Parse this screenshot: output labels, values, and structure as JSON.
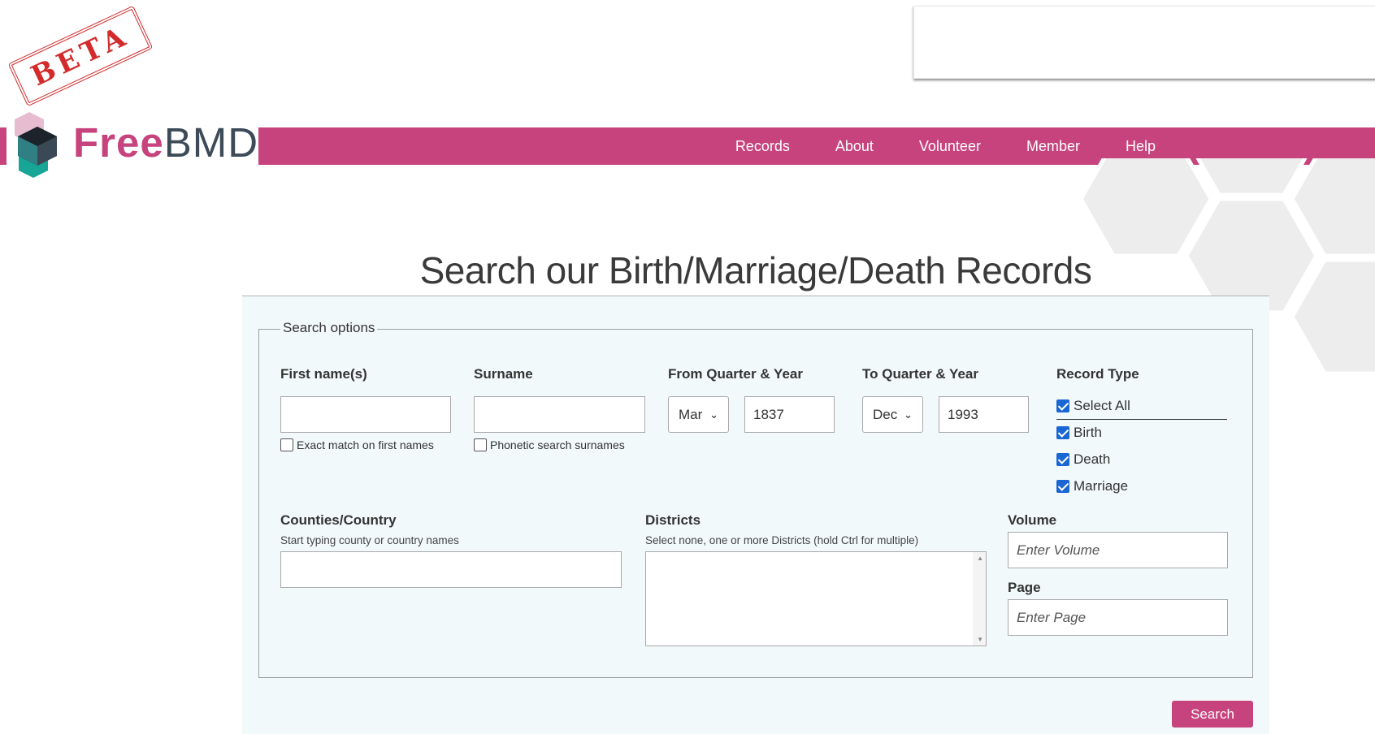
{
  "beta_label": "BETA",
  "brand": {
    "free": "Free",
    "bmd": "BMD",
    "accent": "#c7437d",
    "dark": "#3d4a58"
  },
  "nav": {
    "items": [
      "Records",
      "About",
      "Volunteer",
      "Member",
      "Help"
    ]
  },
  "page_title": "Search our Birth/Marriage/Death Records",
  "form": {
    "legend": "Search options",
    "first_name": {
      "label": "First name(s)",
      "value": "",
      "exact_label": "Exact match on first names",
      "exact_checked": false
    },
    "surname": {
      "label": "Surname",
      "value": "",
      "phonetic_label": "Phonetic search surnames",
      "phonetic_checked": false
    },
    "from": {
      "label": "From Quarter & Year",
      "quarter": "Mar",
      "year": "1837"
    },
    "to": {
      "label": "To Quarter & Year",
      "quarter": "Dec",
      "year": "1993"
    },
    "record_type": {
      "label": "Record Type",
      "options": [
        {
          "label": "Select All",
          "checked": true
        },
        {
          "label": "Birth",
          "checked": true
        },
        {
          "label": "Death",
          "checked": true
        },
        {
          "label": "Marriage",
          "checked": true
        }
      ]
    },
    "counties": {
      "label": "Counties/Country",
      "hint": "Start typing county or country names",
      "value": ""
    },
    "districts": {
      "label": "Districts",
      "hint": "Select none, one or more Districts (hold Ctrl for multiple)"
    },
    "volume": {
      "label": "Volume",
      "placeholder": "Enter Volume"
    },
    "page": {
      "label": "Page",
      "placeholder": "Enter Page"
    },
    "search_label": "Search"
  },
  "icons": {
    "checkbox": "checkbox-icon",
    "dropdown": "chevron-down-icon",
    "scroll": "scroll-arrow-icon",
    "logo": "hexagon-cube-logo"
  }
}
